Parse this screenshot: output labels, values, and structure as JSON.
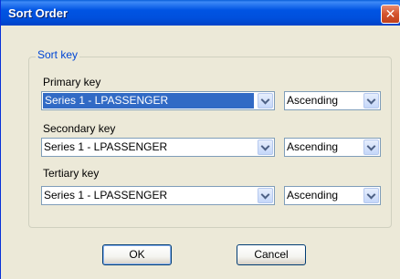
{
  "window": {
    "title": "Sort Order"
  },
  "group": {
    "legend": "Sort key"
  },
  "keys": [
    {
      "label": "Primary key",
      "field": "Series 1 - LPASSENGER",
      "order": "Ascending"
    },
    {
      "label": "Secondary key",
      "field": "Series 1 - LPASSENGER",
      "order": "Ascending"
    },
    {
      "label": "Tertiary key",
      "field": "Series 1 - LPASSENGER",
      "order": "Ascending"
    }
  ],
  "buttons": {
    "ok": "OK",
    "cancel": "Cancel"
  },
  "icons": {
    "close": "close-icon",
    "dropdown": "chevron-down-icon"
  },
  "colors": {
    "titlebar": "#0054e3",
    "selection": "#316ac5",
    "legend": "#0046d5"
  }
}
